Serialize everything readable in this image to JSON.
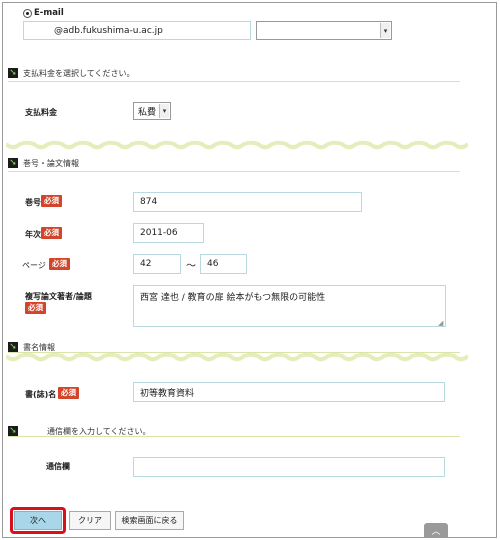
{
  "email": {
    "label": "E-mail",
    "value": "@adb.fukushima-u.ac.jp",
    "domain_select": ""
  },
  "payment_section": {
    "title": "支払料金を選択してください。",
    "label": "支払料金",
    "value": "私費"
  },
  "volume_section": {
    "title": "巻号・論文情報",
    "volume": {
      "label": "巻号",
      "required": "必須",
      "value": "874"
    },
    "year": {
      "label": "年次",
      "required": "必須",
      "value": "2011-06"
    },
    "pages": {
      "label": "ページ",
      "required": "必須",
      "from": "42",
      "separator": "〜",
      "to": "46"
    },
    "article": {
      "label": "複写論文著者/論題",
      "required": "必須",
      "value": "西宮 達也 / 教育の扉 絵本がもつ無限の可能性"
    }
  },
  "book_section": {
    "title": "書名情報",
    "journal": {
      "label": "書(誌)名",
      "required": "必須",
      "value": "初等教育資料"
    }
  },
  "comment_section": {
    "title": "通信欄を入力してください。",
    "label": "通信欄",
    "value": ""
  },
  "buttons": {
    "next": "次へ",
    "clear": "クリア",
    "back": "検索画面に戻る"
  },
  "scroll_top_icon": "chevron-up-icon",
  "colors": {
    "required_badge": "#d2452a",
    "highlight": "#d8101b",
    "primary_button": "#a9d6e8",
    "wave": "#e6edbc"
  }
}
